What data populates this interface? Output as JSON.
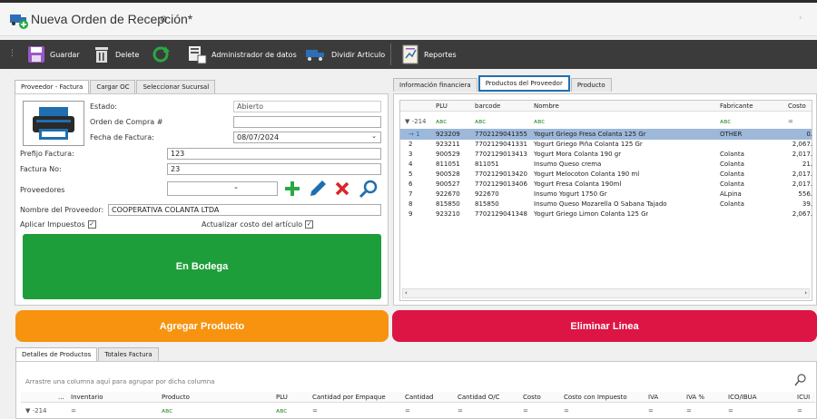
{
  "window": {
    "title": "Nueva Orden de Recepción*"
  },
  "toolbar": {
    "save": "Guardar",
    "delete": "Delete",
    "data_admin": "Administrador de datos",
    "split_article": "Dividir Articulo",
    "reports": "Reportes"
  },
  "left_tabs": [
    "Proveedor - Factura",
    "Cargar OC",
    "Seleccionar Sucursal"
  ],
  "form": {
    "estado_label": "Estado:",
    "estado_value": "Abierto",
    "oc_label": "Orden de Compra #",
    "oc_value": "",
    "fecha_label": "Fecha de Factura:",
    "fecha_value": "08/07/2024",
    "prefijo_label": "Prefijo Factura:",
    "prefijo_value": "123",
    "factura_label": "Factura No:",
    "factura_value": "23",
    "proveedores_label": "Proveedores",
    "proveedores_value": "",
    "nombre_label": "Nombre del Proveedor:",
    "nombre_value": "COOPERATIVA COLANTA LTDA",
    "impuestos_label": "Aplicar Impuestos",
    "actualizar_label": "Actualizar costo del artículo",
    "check_mark": "✓"
  },
  "status_button": {
    "label": "En Bodega",
    "color": "#1e9e3a"
  },
  "add_button": {
    "label": "Agregar Producto",
    "color": "#f7930f"
  },
  "remove_button": {
    "label": "Eliminar Linea",
    "color": "#dc1545"
  },
  "right_tabs": [
    "Información financiera",
    "Productos del Proveedor",
    "Producto"
  ],
  "product_grid": {
    "headers": [
      "PLU",
      "barcode",
      "Nombre",
      "Fabricante",
      "Costo"
    ],
    "filter_row": {
      "first": "▼ -214",
      "abc": "ᴀʙc",
      "eq": "="
    },
    "rows": [
      {
        "ind": "→ 1",
        "plu": "923209",
        "barcode": "7702129041355",
        "nombre": "Yogurt Griego Fresa Colanta 125 Gr",
        "fab": "OTHER",
        "costo": "0."
      },
      {
        "ind": "2",
        "plu": "923211",
        "barcode": "7702129041331",
        "nombre": "Yogurt Griego Piña Colanta 125 Gr",
        "fab": "",
        "costo": "2,067."
      },
      {
        "ind": "3",
        "plu": "900529",
        "barcode": "7702129013413",
        "nombre": "Yogurt Mora Colanta 190 gr",
        "fab": "Colanta",
        "costo": "2,017."
      },
      {
        "ind": "4",
        "plu": "811051",
        "barcode": "811051",
        "nombre": "Insumo Queso crema",
        "fab": "Colanta",
        "costo": "21."
      },
      {
        "ind": "5",
        "plu": "900528",
        "barcode": "7702129013420",
        "nombre": "Yogurt Melocoton Colanta 190 ml",
        "fab": "Colanta",
        "costo": "2,017."
      },
      {
        "ind": "6",
        "plu": "900527",
        "barcode": "7702129013406",
        "nombre": "Yogurt Fresa Colanta 190ml",
        "fab": "Colanta",
        "costo": "2,017."
      },
      {
        "ind": "7",
        "plu": "922670",
        "barcode": "922670",
        "nombre": "Insumo Yogurt 1750 Gr",
        "fab": "ALpina",
        "costo": "556."
      },
      {
        "ind": "8",
        "plu": "815850",
        "barcode": "815850",
        "nombre": "Insumo Queso Mozarella O Sabana Tajado",
        "fab": "Colanta",
        "costo": "39."
      },
      {
        "ind": "9",
        "plu": "923210",
        "barcode": "7702129041348",
        "nombre": "Yogurt Griego Limon Colanta 125 Gr",
        "fab": "",
        "costo": "2,067."
      }
    ]
  },
  "bottom_tabs": [
    "Detalles de Productos",
    "Totales Factura"
  ],
  "detail_grid": {
    "group_hint": "Arrastre una columna aquí para agrupar por dicha columna",
    "headers": [
      "...",
      "Inventario",
      "Producto",
      "PLU",
      "Cantidad por Empaque",
      "Cantidad",
      "Cantidad O/C",
      "Costo",
      "Costo con Impuesto",
      "IVA",
      "IVA %",
      "ICO/IBUA",
      "ICUI"
    ],
    "filter_first": "▼ -214"
  }
}
